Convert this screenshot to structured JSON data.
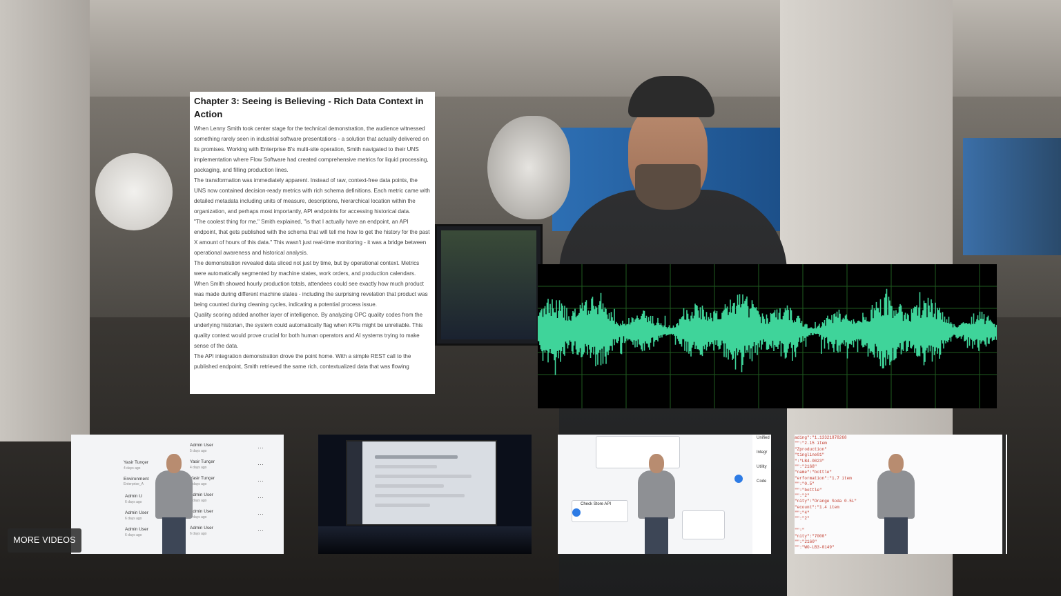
{
  "document": {
    "title": "Chapter 3: Seeing is Believing - Rich Data Context in Action",
    "paragraphs": [
      "When Lenny Smith took center stage for the technical demonstration, the audience witnessed something rarely seen in industrial software presentations - a solution that actually delivered on its promises. Working with Enterprise B's multi-site operation, Smith navigated to their UNS implementation where Flow Software had created comprehensive metrics for liquid processing, packaging, and filling production lines.",
      "The transformation was immediately apparent. Instead of raw, context-free data points, the UNS now contained decision-ready metrics with rich schema definitions. Each metric came with detailed metadata including units of measure, descriptions, hierarchical location within the organization, and perhaps most importantly, API endpoints for accessing historical data.",
      "\"The coolest thing for me,\" Smith explained, \"is that I actually have an endpoint, an API endpoint, that gets published with the schema that will tell me how to get the history for the past X amount of hours of this data.\" This wasn't just real-time monitoring - it was a bridge between operational awareness and historical analysis.",
      "The demonstration revealed data sliced not just by time, but by operational context. Metrics were automatically segmented by machine states, work orders, and production calendars. When Smith showed hourly production totals, attendees could see exactly how much product was made during different machine states - including the surprising revelation that product was being counted during cleaning cycles, indicating a potential process issue.",
      "Quality scoring added another layer of intelligence. By analyzing OPC quality codes from the underlying historian, the system could automatically flag when KPIs might be unreliable. This quality context would prove crucial for both human operators and AI systems trying to make sense of the data.",
      "The API integration demonstration drove the point home. With a simple REST call to the published endpoint, Smith retrieved the same rich, contextualized data that was flowing"
    ]
  },
  "thumbnails": {
    "t1": {
      "rows": [
        {
          "name": "Admin User",
          "time": "5 days ago"
        },
        {
          "name": "Yasir Tunçer",
          "time": "4 days ago"
        },
        {
          "name": "Yasir Tunçer",
          "time": "5 days ago"
        },
        {
          "name": "Admin User",
          "time": "6 days ago"
        },
        {
          "name": "Admin User",
          "time": "6 days ago"
        },
        {
          "name": "Admin User",
          "time": "6 days ago"
        }
      ],
      "left_labels": [
        "Yasir Tunçer",
        "4 days ago",
        "Environment",
        "Enterprise_A",
        "Admin U",
        "6 days ago",
        "Admin User",
        "6 days ago",
        "Admin User",
        "6 days ago"
      ]
    },
    "t3": {
      "node_title": "Check Store API",
      "side_items": [
        "Unified",
        "Integr",
        "Utility",
        "Code"
      ]
    },
    "t4": {
      "code_lines": [
        "ading\":\"1.13321878268",
        "\"\":\"2.15 item",
        "\"Zproduction\"",
        "\"tingline01\"",
        "\":\"LB4-0023\"",
        "\"\":\"2168\"",
        "\"name\":\"bottle\"",
        "\"erformation\":\"1.7 item",
        "\"\":\"0.5\"",
        "\"\":\"bottle\"",
        "\"\":\"2\"",
        "\"nity\":\"Orange Soda 0.5L\"",
        "\"ecount\":\"1.4 item",
        "\"\":\"4\"",
        "\"\":\"2\"",
        "",
        "\"\":\"",
        "\"nity\":\"7000\"",
        "\"\":\"2160\"",
        "\"\":\"WO-LB3-0149\""
      ]
    }
  },
  "buttons": {
    "more_videos": "MORE VIDEOS"
  },
  "colors": {
    "waveform": "#3fd49a",
    "waveform_grid": "#1f5b1f",
    "doc_background": "#ffffff"
  }
}
